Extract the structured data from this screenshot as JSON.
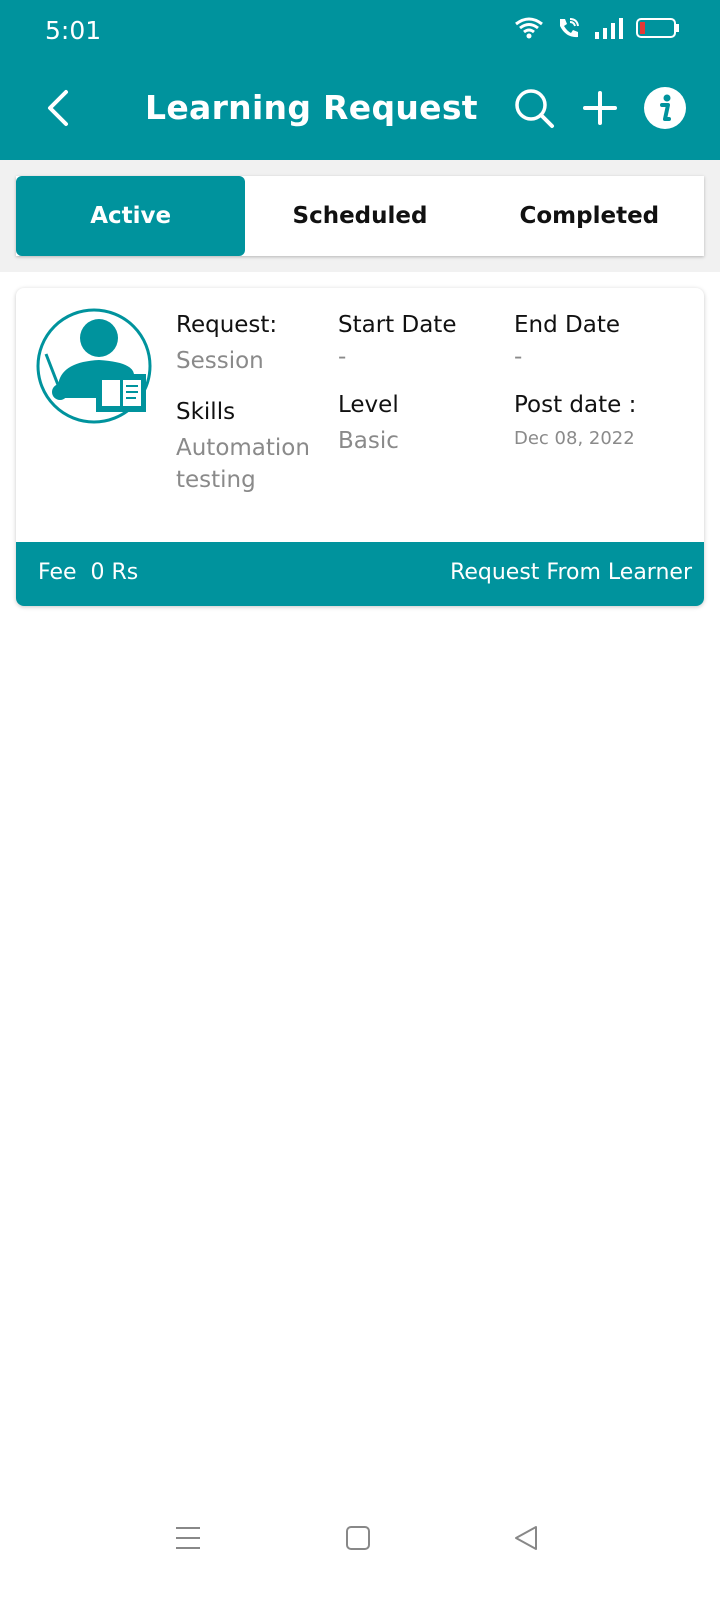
{
  "status_bar": {
    "time": "5:01"
  },
  "header": {
    "title": "Learning Request"
  },
  "tabs": [
    {
      "label": "Active"
    },
    {
      "label": "Scheduled"
    },
    {
      "label": "Completed"
    }
  ],
  "request_card": {
    "request_label": "Request:",
    "request_value": "Session",
    "start_date_label": "Start Date",
    "start_date_value": "-",
    "end_date_label": "End Date",
    "end_date_value": "-",
    "skills_label": "Skills",
    "skills_value_line1": "Automation",
    "skills_value_line2": "testing",
    "level_label": "Level",
    "level_value": "Basic",
    "post_date_label": "Post date :",
    "post_date_value": "Dec 08, 2022",
    "fee": "Fee  0 Rs",
    "source": "Request From Learner"
  },
  "colors": {
    "accent": "#00939d",
    "battery_low": "#e53935"
  },
  "icons": [
    "back-arrow-icon",
    "search-icon",
    "plus-icon",
    "info-icon",
    "wifi-icon",
    "wifi-call-icon",
    "signal-icon",
    "battery-icon",
    "teacher-avatar-icon",
    "menu-icon",
    "home-icon",
    "back-triangle-icon"
  ]
}
